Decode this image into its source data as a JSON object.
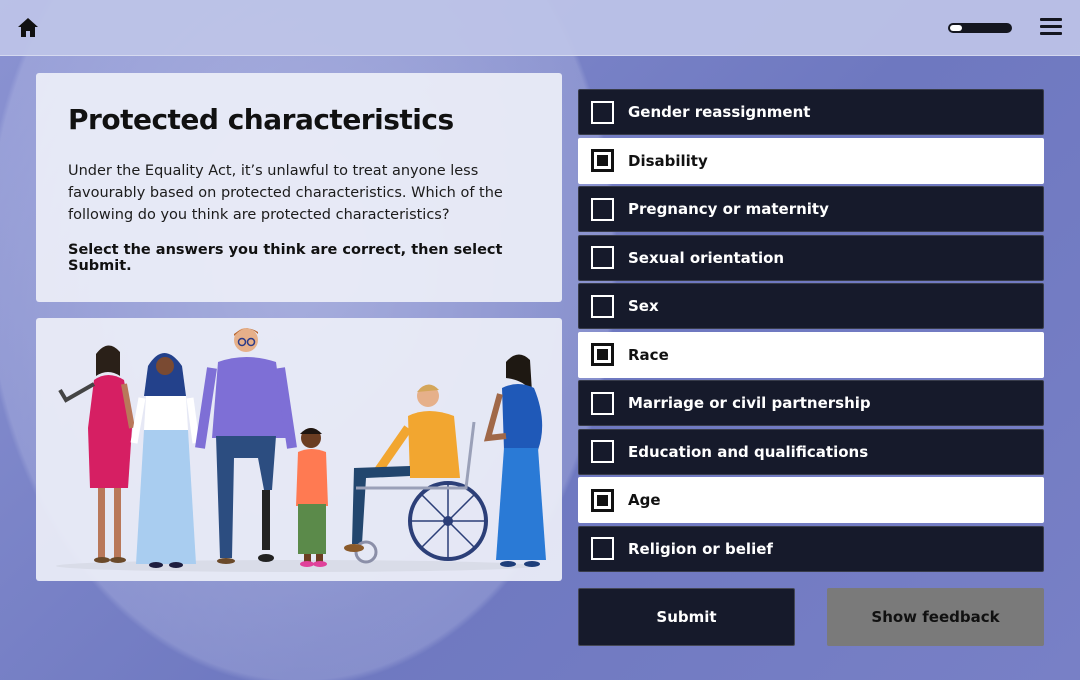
{
  "topbar": {
    "home_icon": "home-icon",
    "menu_icon": "hamburger-menu-icon",
    "progress_fraction": 0.2
  },
  "intro": {
    "title": "Protected characteristics",
    "body": "Under the Equality Act, it’s unlawful to treat anyone less favourably based on protected characteristics. Which of the following do you think are protected characteristics?",
    "instruction": "Select the answers you think are correct, then select Submit."
  },
  "options": [
    {
      "label": "Gender reassignment",
      "selected": false
    },
    {
      "label": "Disability",
      "selected": true
    },
    {
      "label": "Pregnancy or maternity",
      "selected": false
    },
    {
      "label": "Sexual orientation",
      "selected": false
    },
    {
      "label": "Sex",
      "selected": false
    },
    {
      "label": "Race",
      "selected": true
    },
    {
      "label": "Marriage or civil partnership",
      "selected": false
    },
    {
      "label": "Education and qualifications",
      "selected": false
    },
    {
      "label": "Age",
      "selected": true
    },
    {
      "label": "Religion or belief",
      "selected": false
    }
  ],
  "buttons": {
    "submit_label": "Submit",
    "feedback_label": "Show feedback"
  },
  "colors": {
    "option_dark": "#161a2b",
    "option_selected": "#ffffff",
    "feedback_button": "#7a7a7a"
  }
}
